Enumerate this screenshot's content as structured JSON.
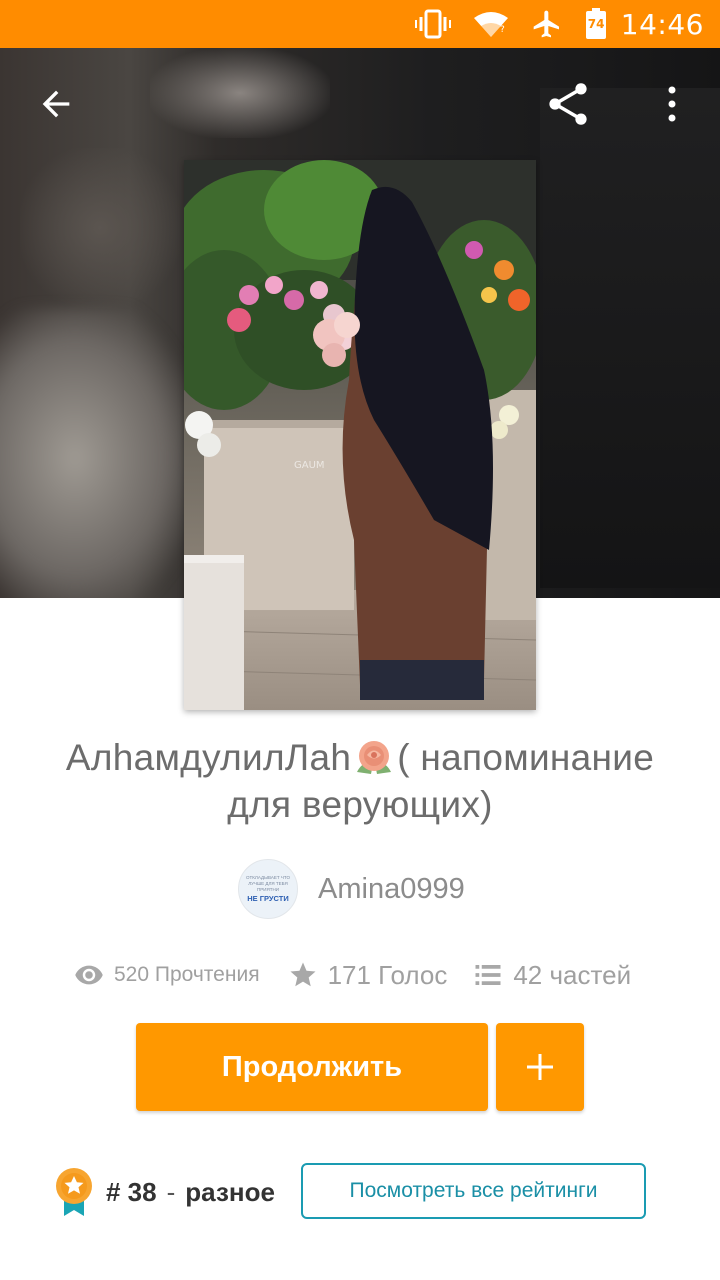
{
  "status_bar": {
    "time": "14:46",
    "battery_level": "74",
    "icons": [
      "vibrate-icon",
      "wifi-icon",
      "airplane-icon",
      "battery-icon"
    ]
  },
  "toolbar": {
    "icons": [
      "back-arrow-icon",
      "share-icon",
      "more-vert-icon"
    ]
  },
  "story": {
    "title_part1": "АлhамдулилЛаh",
    "title_part2": "( напоминание для верующих)",
    "cover_watermark": "GAUM",
    "author": {
      "name": "Amina0999",
      "avatar_small_text": "ОТКЛАДЫВАЕТ ЧТО ЛУЧШЕ ДЛЯ ТЕБЯ ПРИЯТНИ",
      "avatar_main_text": "НЕ ГРУСТИ"
    },
    "stats": {
      "reads": "520 Прочтения",
      "votes": "171 Голос",
      "parts": "42 частей"
    }
  },
  "actions": {
    "continue_label": "Продолжить",
    "add_icon": "plus-icon"
  },
  "ranking": {
    "rank": "# 38",
    "separator": "-",
    "category": "разное",
    "view_all_label": "Посмотреть все рейтинги"
  },
  "colors": {
    "status_bar": "#ff8c00",
    "accent": "#ff9800",
    "rank_button_border": "#1a9bb2",
    "medal": "#f7a530",
    "ribbon": "#1aa5b5"
  }
}
